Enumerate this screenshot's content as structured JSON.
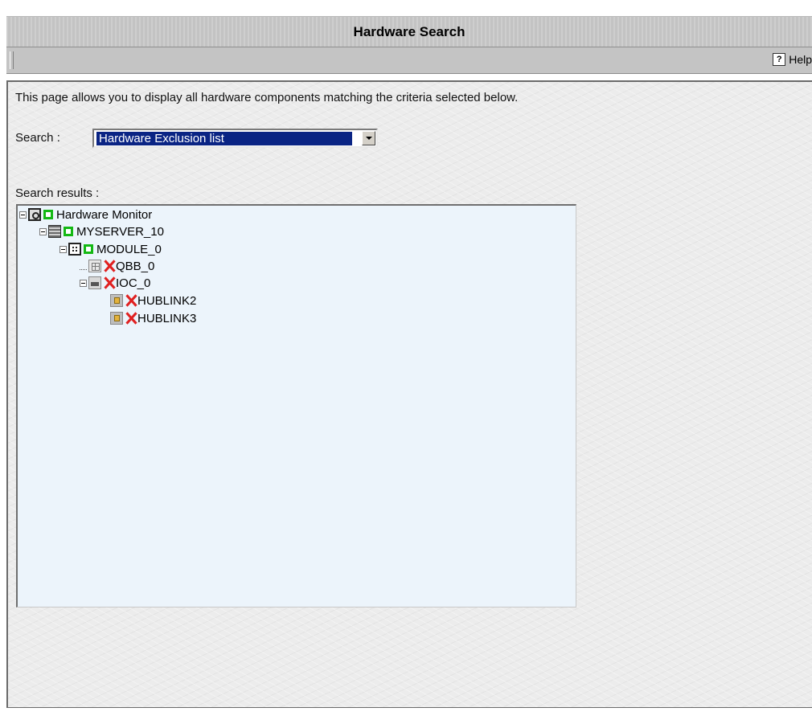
{
  "page": {
    "title": "Hardware Search",
    "help_label": "Help",
    "help_icon": "help-icon",
    "intro_text": "This page allows you to display all hardware components matching the criteria selected below."
  },
  "search": {
    "label": "Search :",
    "selected_value": "Hardware Exclusion list"
  },
  "results": {
    "label": "Search results :",
    "tree": [
      {
        "label": "Hardware Monitor",
        "depth": 0,
        "expanded": true,
        "status": "ok",
        "icon": "monitor-icon"
      },
      {
        "label": "MYSERVER_10",
        "depth": 1,
        "expanded": true,
        "status": "ok",
        "icon": "server-icon"
      },
      {
        "label": "MODULE_0",
        "depth": 2,
        "expanded": true,
        "status": "ok",
        "icon": "module-icon"
      },
      {
        "label": "QBB_0",
        "depth": 3,
        "expanded": false,
        "status": "excluded",
        "icon": "qbb-icon"
      },
      {
        "label": "IOC_0",
        "depth": 3,
        "expanded": true,
        "status": "excluded",
        "icon": "ioc-icon"
      },
      {
        "label": "HUBLINK2",
        "depth": 4,
        "expanded": false,
        "status": "excluded",
        "icon": "hublink-icon"
      },
      {
        "label": "HUBLINK3",
        "depth": 4,
        "expanded": false,
        "status": "excluded",
        "icon": "hublink-icon"
      }
    ]
  },
  "colors": {
    "status_ok": "#14b814",
    "status_excluded": "#e02020",
    "selection": "#0a2484",
    "tree_background": "#ecf4fb"
  }
}
